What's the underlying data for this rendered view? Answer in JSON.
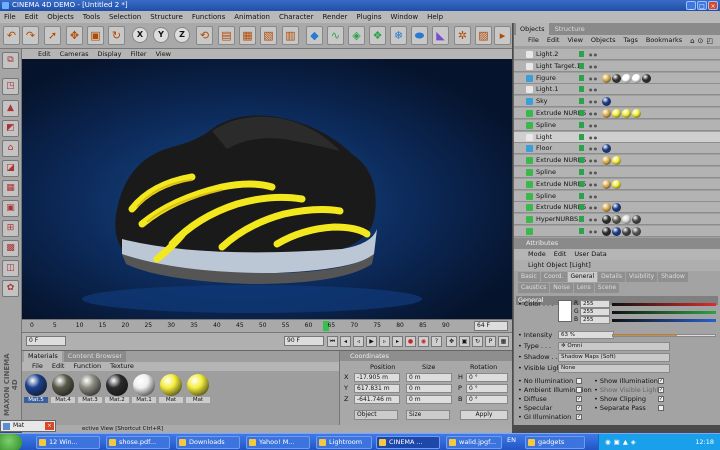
{
  "window": {
    "title": "CINEMA 4D DEMO - [Untitled 2 *]"
  },
  "menu": [
    "File",
    "Edit",
    "Objects",
    "Tools",
    "Selection",
    "Structure",
    "Functions",
    "Animation",
    "Character",
    "Render",
    "Plugins",
    "Window",
    "Help"
  ],
  "toolbar": {
    "xyz": [
      "X",
      "Y",
      "Z"
    ]
  },
  "viewport": {
    "menu": [
      "Edit",
      "Cameras",
      "Display",
      "Filter",
      "View"
    ]
  },
  "timeline": {
    "ticks": [
      "0",
      "5",
      "10",
      "15",
      "20",
      "25",
      "30",
      "35",
      "40",
      "45",
      "50",
      "55",
      "60",
      "65",
      "70",
      "75",
      "80",
      "85",
      "90"
    ],
    "frame_end": "64 F",
    "current_frame": 64
  },
  "transport": {
    "start_field": "0 F",
    "end_field": "90 F"
  },
  "materials": {
    "tabs": [
      "Materials",
      "Content Browser"
    ],
    "menu": [
      "File",
      "Edit",
      "Function",
      "Texture"
    ],
    "items": [
      {
        "label": "Mat.5",
        "color": "#1c3f8c"
      },
      {
        "label": "Mat.4",
        "color": "#5a5a4a"
      },
      {
        "label": "Mat.3",
        "color": "#8a8a80"
      },
      {
        "label": "Mat.2",
        "color": "#2a2a2a"
      },
      {
        "label": "Mat.1",
        "color": "#f0f0f0"
      },
      {
        "label": "Mat",
        "color": "#f4ee3a"
      },
      {
        "label": "Mat",
        "color": "#f4ee3a"
      }
    ]
  },
  "coordinates": {
    "title": "Coordinates",
    "headers": [
      "Position",
      "Size",
      "Rotation"
    ],
    "rows": [
      {
        "axis": "X",
        "pos": "-17.905 m",
        "size": "0 m",
        "rot": "H",
        "rotval": "0 °"
      },
      {
        "axis": "Y",
        "pos": "617.831 m",
        "size": "0 m",
        "rot": "P",
        "rotval": "0 °"
      },
      {
        "axis": "Z",
        "pos": "-641.746 m",
        "size": "0 m",
        "rot": "B",
        "rotval": "0 °"
      }
    ],
    "mode_select": "Object",
    "size_select": "Size",
    "apply": "Apply"
  },
  "objects_panel": {
    "tabs": [
      "Objects",
      "Structure"
    ],
    "menu": [
      "File",
      "Edit",
      "View",
      "Objects",
      "Tags",
      "Bookmarks"
    ],
    "items": [
      {
        "name": "Light.2",
        "icon": "#e8e8e8",
        "tags": []
      },
      {
        "name": "Light Target.1",
        "icon": "#e8e8e8",
        "tags": []
      },
      {
        "name": "Figure",
        "icon": "#3a9fd8",
        "tags": [
          "#e0b050",
          "#333",
          "#fff",
          "#ffffff",
          "#2a2a2a"
        ]
      },
      {
        "name": "Light.1",
        "icon": "#e8e8e8",
        "tags": []
      },
      {
        "name": "Sky",
        "icon": "#3a9fd8",
        "tags": [
          "#1a3a8a"
        ]
      },
      {
        "name": "Extrude NURBS",
        "icon": "#3ab84a",
        "tags": [
          "#e0b050",
          "#f4ee3a",
          "#f4ee3a",
          "#f4ee3a"
        ]
      },
      {
        "name": "Spline",
        "icon": "#3ab84a",
        "tags": []
      },
      {
        "name": "Light",
        "icon": "#e8e8e8",
        "tags": []
      },
      {
        "name": "Floor",
        "icon": "#3a9fd8",
        "tags": [
          "#1a3a8a"
        ]
      },
      {
        "name": "Extrude NURBS",
        "icon": "#3ab84a",
        "tags": [
          "#e0b050",
          "#f4ee3a"
        ]
      },
      {
        "name": "Spline",
        "icon": "#3ab84a",
        "tags": []
      },
      {
        "name": "Extrude NURBS",
        "icon": "#3ab84a",
        "tags": [
          "#e0b050",
          "#f4ee3a"
        ]
      },
      {
        "name": "Spline",
        "icon": "#3ab84a",
        "tags": []
      },
      {
        "name": "Extrude NURBS",
        "icon": "#3ab84a",
        "tags": [
          "#e0b050",
          "#1a3a8a"
        ]
      },
      {
        "name": "HyperNURBS.1",
        "icon": "#3ab84a",
        "tags": [
          "#2a2a2a",
          "#5a5a4a",
          "#ddd",
          "#444"
        ]
      },
      {
        "name": "",
        "icon": "#3ab84a",
        "tags": [
          "#2a2a2a",
          "#1a3a8a",
          "#444",
          "#555"
        ]
      }
    ]
  },
  "attributes": {
    "title": "Attributes",
    "menu": [
      "Mode",
      "Edit",
      "User Data"
    ],
    "object_title": "Light Object [Light]",
    "tabs": [
      "Basic",
      "Coord.",
      "General",
      "Details",
      "Visibility",
      "Shadow",
      "Caustics",
      "Noise",
      "Lens",
      "Scene"
    ],
    "active_tab": "General",
    "section": "General",
    "color_label": "Color",
    "rgb": [
      {
        "ch": "R",
        "val": "255"
      },
      {
        "ch": "G",
        "val": "255"
      },
      {
        "ch": "B",
        "val": "255"
      }
    ],
    "intensity_label": "Intensity",
    "intensity_value": "63 %",
    "type_label": "Type",
    "type_value": "Omni",
    "shadow_label": "Shadow",
    "shadow_value": "Shadow Maps (Soft)",
    "visible_light_label": "Visible Light",
    "visible_light_value": "None",
    "checks_left": [
      "No Illumination",
      "Ambient Illumination",
      "Diffuse",
      "Specular",
      "GI Illumination"
    ],
    "checks_right": [
      "Show Illumination",
      "Show Visible Light",
      "Show Clipping",
      "Separate Pass"
    ]
  },
  "statusbar": {
    "text": "ective View [Shortcut Ctrl+R]"
  },
  "brand": "MAXON CINEMA 4D",
  "popup": {
    "label": "Mat"
  },
  "taskbar": {
    "items": [
      "12 Win...",
      "shose.pdf...",
      "Downloads",
      "Yahoo! M...",
      "Lightroom",
      "CINEMA ...",
      "walid.jpgf...",
      "gadgets"
    ],
    "lang": "EN",
    "clock": "12:18"
  }
}
